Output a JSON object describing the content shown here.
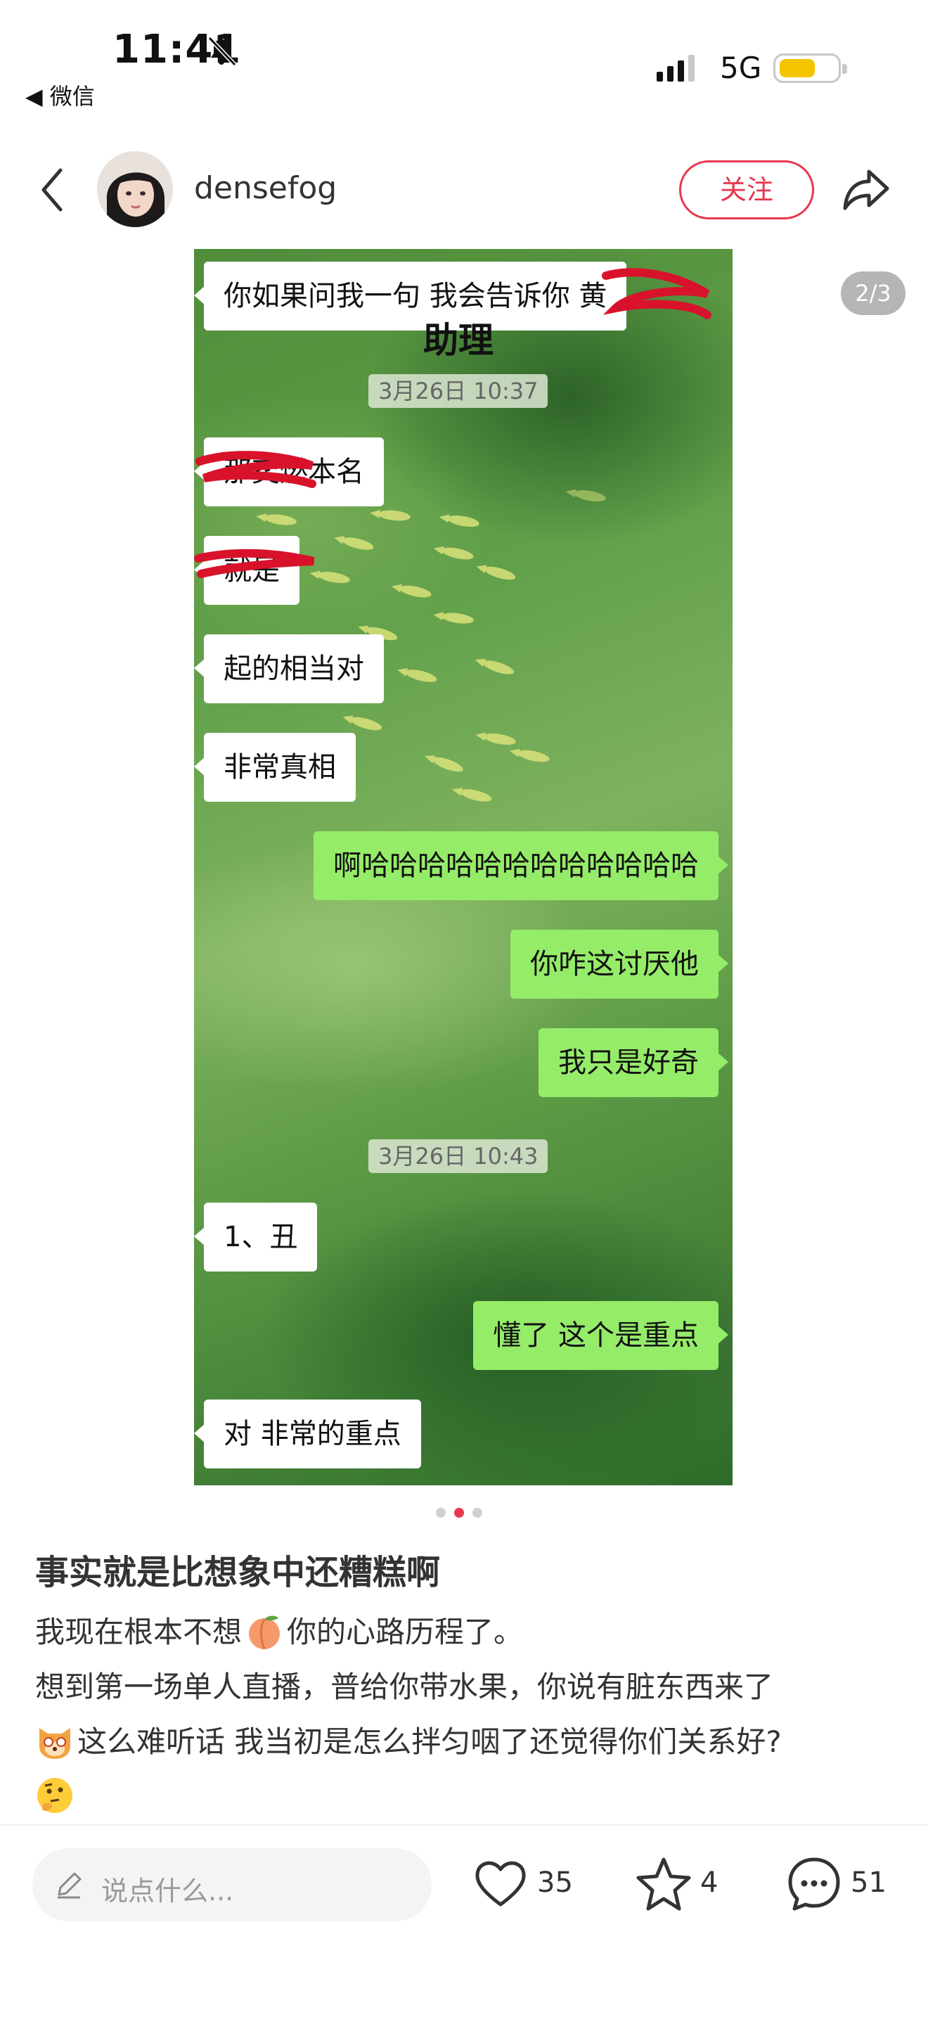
{
  "status_bar": {
    "time": "11:41",
    "back_app": "◀ 微信",
    "network": "5G"
  },
  "header": {
    "username": "densefog",
    "follow_label": "关注"
  },
  "image": {
    "counter": "2/3",
    "assistant_label": "助理",
    "messages": [
      {
        "side": "left",
        "text": "你如果问我一句 我会告诉你 黄"
      },
      {
        "side": "stamp",
        "text": "3月26日 10:37"
      },
      {
        "side": "left",
        "text": "那奕燃本名"
      },
      {
        "side": "left",
        "text": "就是"
      },
      {
        "side": "left",
        "text": "起的相当对"
      },
      {
        "side": "left",
        "text": "非常真相"
      },
      {
        "side": "right",
        "text": "啊哈哈哈哈哈哈哈哈哈哈哈哈"
      },
      {
        "side": "right",
        "text": "你咋这讨厌他"
      },
      {
        "side": "right",
        "text": "我只是好奇"
      },
      {
        "side": "stamp",
        "text": "3月26日 10:43"
      },
      {
        "side": "left",
        "text": "1、丑"
      },
      {
        "side": "right",
        "text": "懂了 这个是重点"
      },
      {
        "side": "left",
        "text": "对 非常的重点"
      }
    ]
  },
  "pager": {
    "count": 3,
    "active": 2
  },
  "post": {
    "title": "事实就是比想象中还糟糕啊",
    "line1_a": "我现在根本不想",
    "line1_b": "你的心路历程了。",
    "line2": "想到第一场单人直播，普给你带水果，你说有脏东西来了",
    "line3": "这么难听话 我当初是怎么拌匀咽了还觉得你们关系好?"
  },
  "bottom_bar": {
    "comment_placeholder": "说点什么...",
    "likes": "35",
    "favorites": "4",
    "comments": "51"
  },
  "colors": {
    "accent": "#e8384f",
    "bubble_green": "#95ec69"
  },
  "icons": [
    "bell-off-icon",
    "back-arrow-icon",
    "share-icon",
    "pen-icon",
    "heart-icon",
    "star-icon",
    "comment-icon",
    "peach-emoji",
    "dog-emoji",
    "thinking-emoji"
  ]
}
